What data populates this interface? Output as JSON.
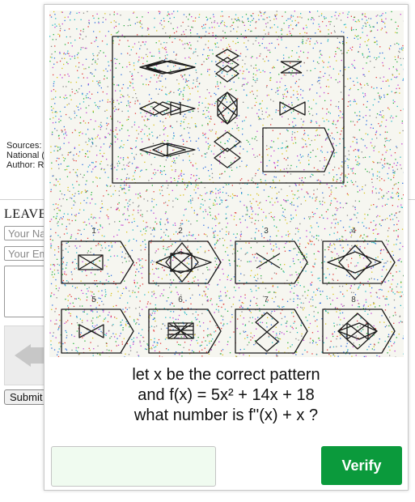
{
  "background_page": {
    "sources_label": "Sources:",
    "national_label": "National (",
    "author_label": "Author: R",
    "leave_heading": "LEAVE",
    "name_placeholder": "Your Na",
    "email_placeholder": "Your Em",
    "submit_label": "Submit"
  },
  "captcha": {
    "option_numbers": [
      "1",
      "2",
      "3",
      "4",
      "5",
      "6",
      "7",
      "8"
    ],
    "question_lines": [
      "let x be the correct pattern",
      "and f(x) = 5x² + 14x + 18",
      "what number is f''(x) + x ?"
    ],
    "answer_value": "",
    "verify_label": "Verify"
  },
  "colors": {
    "verify_bg": "#0b9a3c",
    "answer_bg": "#f0fbf0",
    "noise_colors": [
      "#e23b3b",
      "#2f6fe0",
      "#27b03c",
      "#d8c21a",
      "#c23fd4",
      "#23b8c4",
      "#888888"
    ]
  }
}
